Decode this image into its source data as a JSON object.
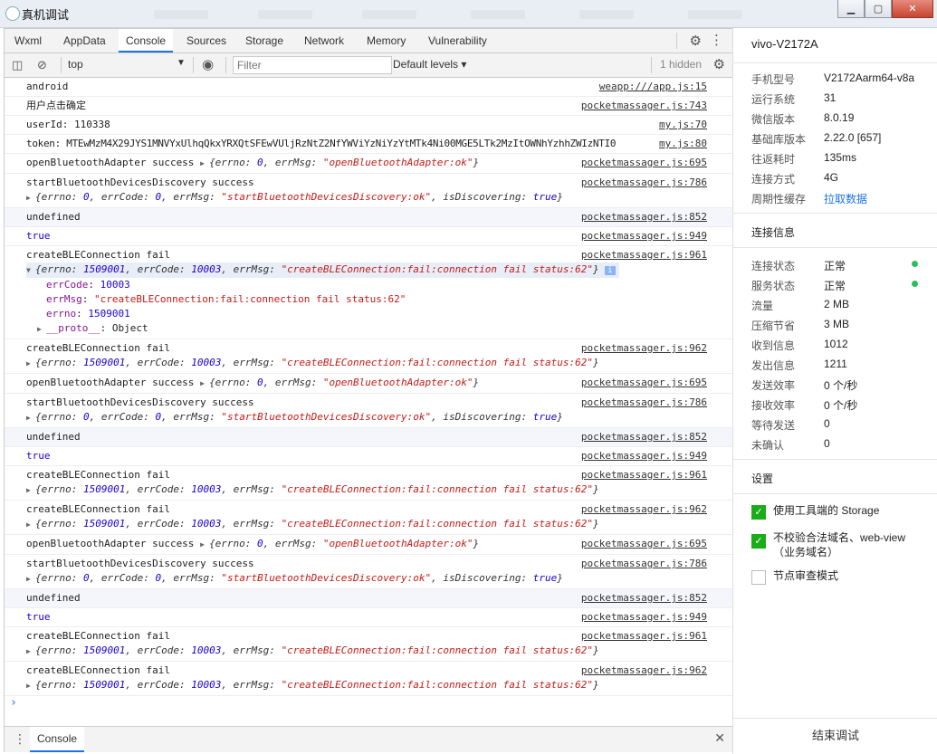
{
  "window": {
    "title": "真机调试"
  },
  "tabs": [
    "Wxml",
    "AppData",
    "Console",
    "Sources",
    "Storage",
    "Network",
    "Memory",
    "Vulnerability"
  ],
  "active_tab": "Console",
  "toolbar": {
    "context": "top",
    "filter_placeholder": "Filter",
    "levels": "Default levels",
    "hidden": "1 hidden"
  },
  "console": {
    "r0": {
      "text": "android",
      "src": "weapp:///app.js:15"
    },
    "r1": {
      "text": "用户点击确定",
      "src": "pocketmassager.js:743"
    },
    "r2": {
      "text": "userId: 110338",
      "src": "my.js:70"
    },
    "r3": {
      "text": "token: MTEwMzM4X29JYS1MNVYxUlhqQkxYRXQtSFEwVUljRzNtZ2NfYWViYzNiYzYtMTk4Ni00MGE5LTk2MzItOWNhYzhhZWIzNTI0",
      "src": "my.js:80"
    },
    "r4": {
      "text": "openBluetoothAdapter success",
      "src": "pocketmassager.js:695",
      "s": "\"openBluetoothAdapter:ok\""
    },
    "r5": {
      "text": "startBluetoothDevicesDiscovery success",
      "src": "pocketmassager.js:786",
      "s": "\"startBluetoothDevicesDiscovery:ok\""
    },
    "r6": {
      "text": "undefined",
      "src": "pocketmassager.js:852"
    },
    "r7": {
      "text": "true",
      "src": "pocketmassager.js:949"
    },
    "r8": {
      "text": "createBLEConnection fail",
      "src": "pocketmassager.js:961",
      "s": "\"createBLEConnection:fail:connection fail status:62\"",
      "errCode": "10003",
      "errno": "1509001",
      "proto": "Object"
    },
    "r9": {
      "text": "createBLEConnection fail",
      "src": "pocketmassager.js:962"
    },
    "r10": {
      "text": "openBluetoothAdapter success",
      "src": "pocketmassager.js:695"
    },
    "r11": {
      "text": "startBluetoothDevicesDiscovery success",
      "src": "pocketmassager.js:786"
    },
    "r12": {
      "text": "undefined",
      "src": "pocketmassager.js:852"
    },
    "r13": {
      "text": "true",
      "src": "pocketmassager.js:949"
    },
    "r14": {
      "text": "createBLEConnection fail",
      "src": "pocketmassager.js:961"
    },
    "r15": {
      "text": "createBLEConnection fail",
      "src": "pocketmassager.js:962"
    },
    "r16": {
      "text": "openBluetoothAdapter success",
      "src": "pocketmassager.js:695"
    },
    "r17": {
      "text": "startBluetoothDevicesDiscovery success",
      "src": "pocketmassager.js:786"
    },
    "r18": {
      "text": "undefined",
      "src": "pocketmassager.js:852"
    },
    "r19": {
      "text": "true",
      "src": "pocketmassager.js:949"
    },
    "r20": {
      "text": "createBLEConnection fail",
      "src": "pocketmassager.js:961"
    },
    "r21": {
      "text": "createBLEConnection fail",
      "src": "pocketmassager.js:962"
    }
  },
  "drawer": {
    "tab": "Console"
  },
  "side": {
    "device": "vivo-V2172A",
    "info": [
      {
        "k": "手机型号",
        "v": "V2172Aarm64-v8a"
      },
      {
        "k": "运行系统",
        "v": "31"
      },
      {
        "k": "微信版本",
        "v": "8.0.19"
      },
      {
        "k": "基础库版本",
        "v": "2.22.0 [657]"
      },
      {
        "k": "往返耗时",
        "v": "135ms"
      },
      {
        "k": "连接方式",
        "v": "4G"
      },
      {
        "k": "周期性缓存",
        "v": "拉取数据"
      }
    ],
    "conn_title": "连接信息",
    "conn": [
      {
        "k": "连接状态",
        "v": "正常"
      },
      {
        "k": "服务状态",
        "v": "正常"
      },
      {
        "k": "流量",
        "v": "2 MB"
      },
      {
        "k": "压缩节省",
        "v": "3 MB"
      },
      {
        "k": "收到信息",
        "v": "1012"
      },
      {
        "k": "发出信息",
        "v": "1211"
      },
      {
        "k": "发送效率",
        "v": "0 个/秒"
      },
      {
        "k": "接收效率",
        "v": "0 个/秒"
      },
      {
        "k": "等待发送",
        "v": "0"
      },
      {
        "k": "未确认",
        "v": "0"
      }
    ],
    "settings_title": "设置",
    "settings": [
      {
        "label": "使用工具端的 Storage",
        "checked": true
      },
      {
        "label": "不校验合法域名、web-view（业务域名）",
        "checked": true
      },
      {
        "label": "节点审查模式",
        "checked": false
      }
    ],
    "end_button": "结束调试",
    "status_color": "#2bbf5b"
  },
  "colors": {
    "accent": "#1a73e8",
    "checkbox": "#1aad19"
  }
}
